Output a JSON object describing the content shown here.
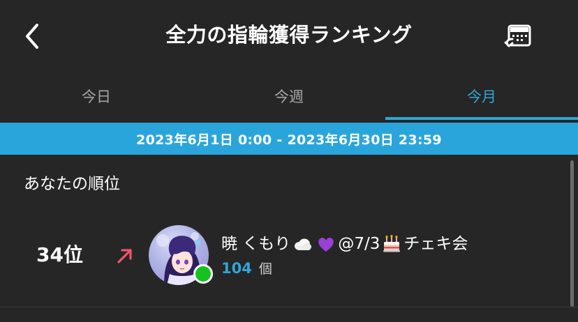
{
  "header": {
    "title": "全力の指輪獲得ランキング",
    "back_icon": "chevron-left-icon",
    "calendar_icon": "calendar-return-icon"
  },
  "tabs": [
    {
      "label": "今日",
      "active": false
    },
    {
      "label": "今週",
      "active": false
    },
    {
      "label": "今月",
      "active": true
    }
  ],
  "period": {
    "range": "2023年6月1日 0:00 - 2023年6月30日 23:59"
  },
  "my_rank": {
    "section_title": "あなたの順位",
    "rank": "34位",
    "trend": "up",
    "user": {
      "name_prefix": "暁 くもり",
      "name_mid": "@7/3",
      "name_suffix": "チェキ会",
      "emojis": [
        "cloud-emoji",
        "purple-heart-emoji",
        "birthday-cake-emoji"
      ],
      "online": true
    },
    "count": "104",
    "count_unit": "個"
  },
  "colors": {
    "background": "#262626",
    "accent": "#2fa6d6",
    "date_band": "#2aa5dc",
    "trend_up": "#f0566b",
    "online": "#16c21f"
  }
}
